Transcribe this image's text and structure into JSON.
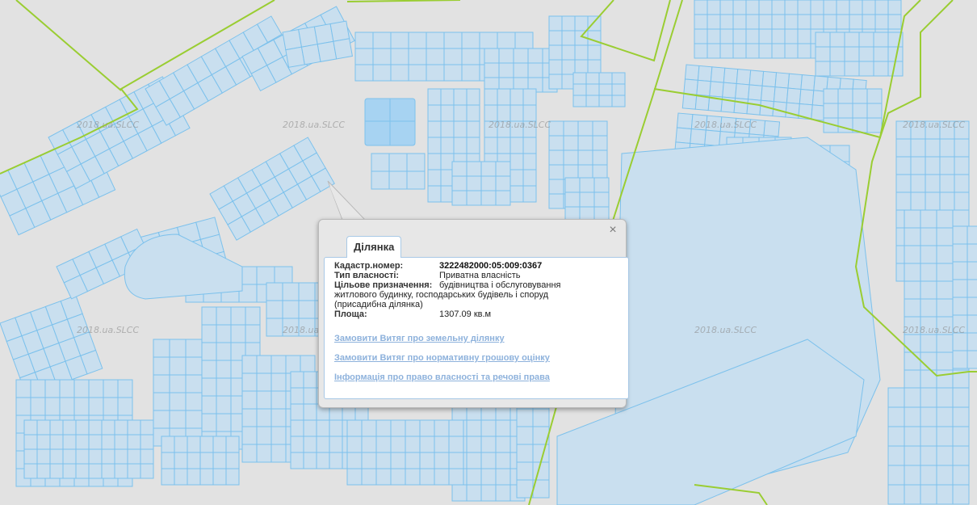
{
  "map": {
    "watermark_text": "2018.ua.SLCC",
    "colors": {
      "background": "#e2e2e2",
      "parcel_fill": "#c9dfef",
      "parcel_stroke": "#7cc1ec",
      "parcel_highlight": "#a7d3f2",
      "boundary_line": "#9acd32"
    }
  },
  "popup": {
    "tab_label": "Ділянка",
    "close_label": "×",
    "fields": {
      "cadastral_label": "Кадастр.номер:",
      "cadastral_value": "3222482000:05:009:0367",
      "ownership_label": "Тип власності:",
      "ownership_value": "Приватна власність",
      "purpose_label": "Цільове призначення:",
      "purpose_value_line1": "будівництва і обслуговування",
      "purpose_value_rest": "житлового будинку, господарських будівель і споруд",
      "purpose_value_rest2": "(присадибна ділянка)",
      "area_label": "Площа:",
      "area_value": "1307.09 кв.м"
    },
    "links": {
      "extract_land": "Замовити Витяг про земельну ділянку",
      "extract_valuation": "Замовити Витяг про нормативну грошову оцінку",
      "ownership_info": "Інформація про право власності та речові права"
    }
  }
}
